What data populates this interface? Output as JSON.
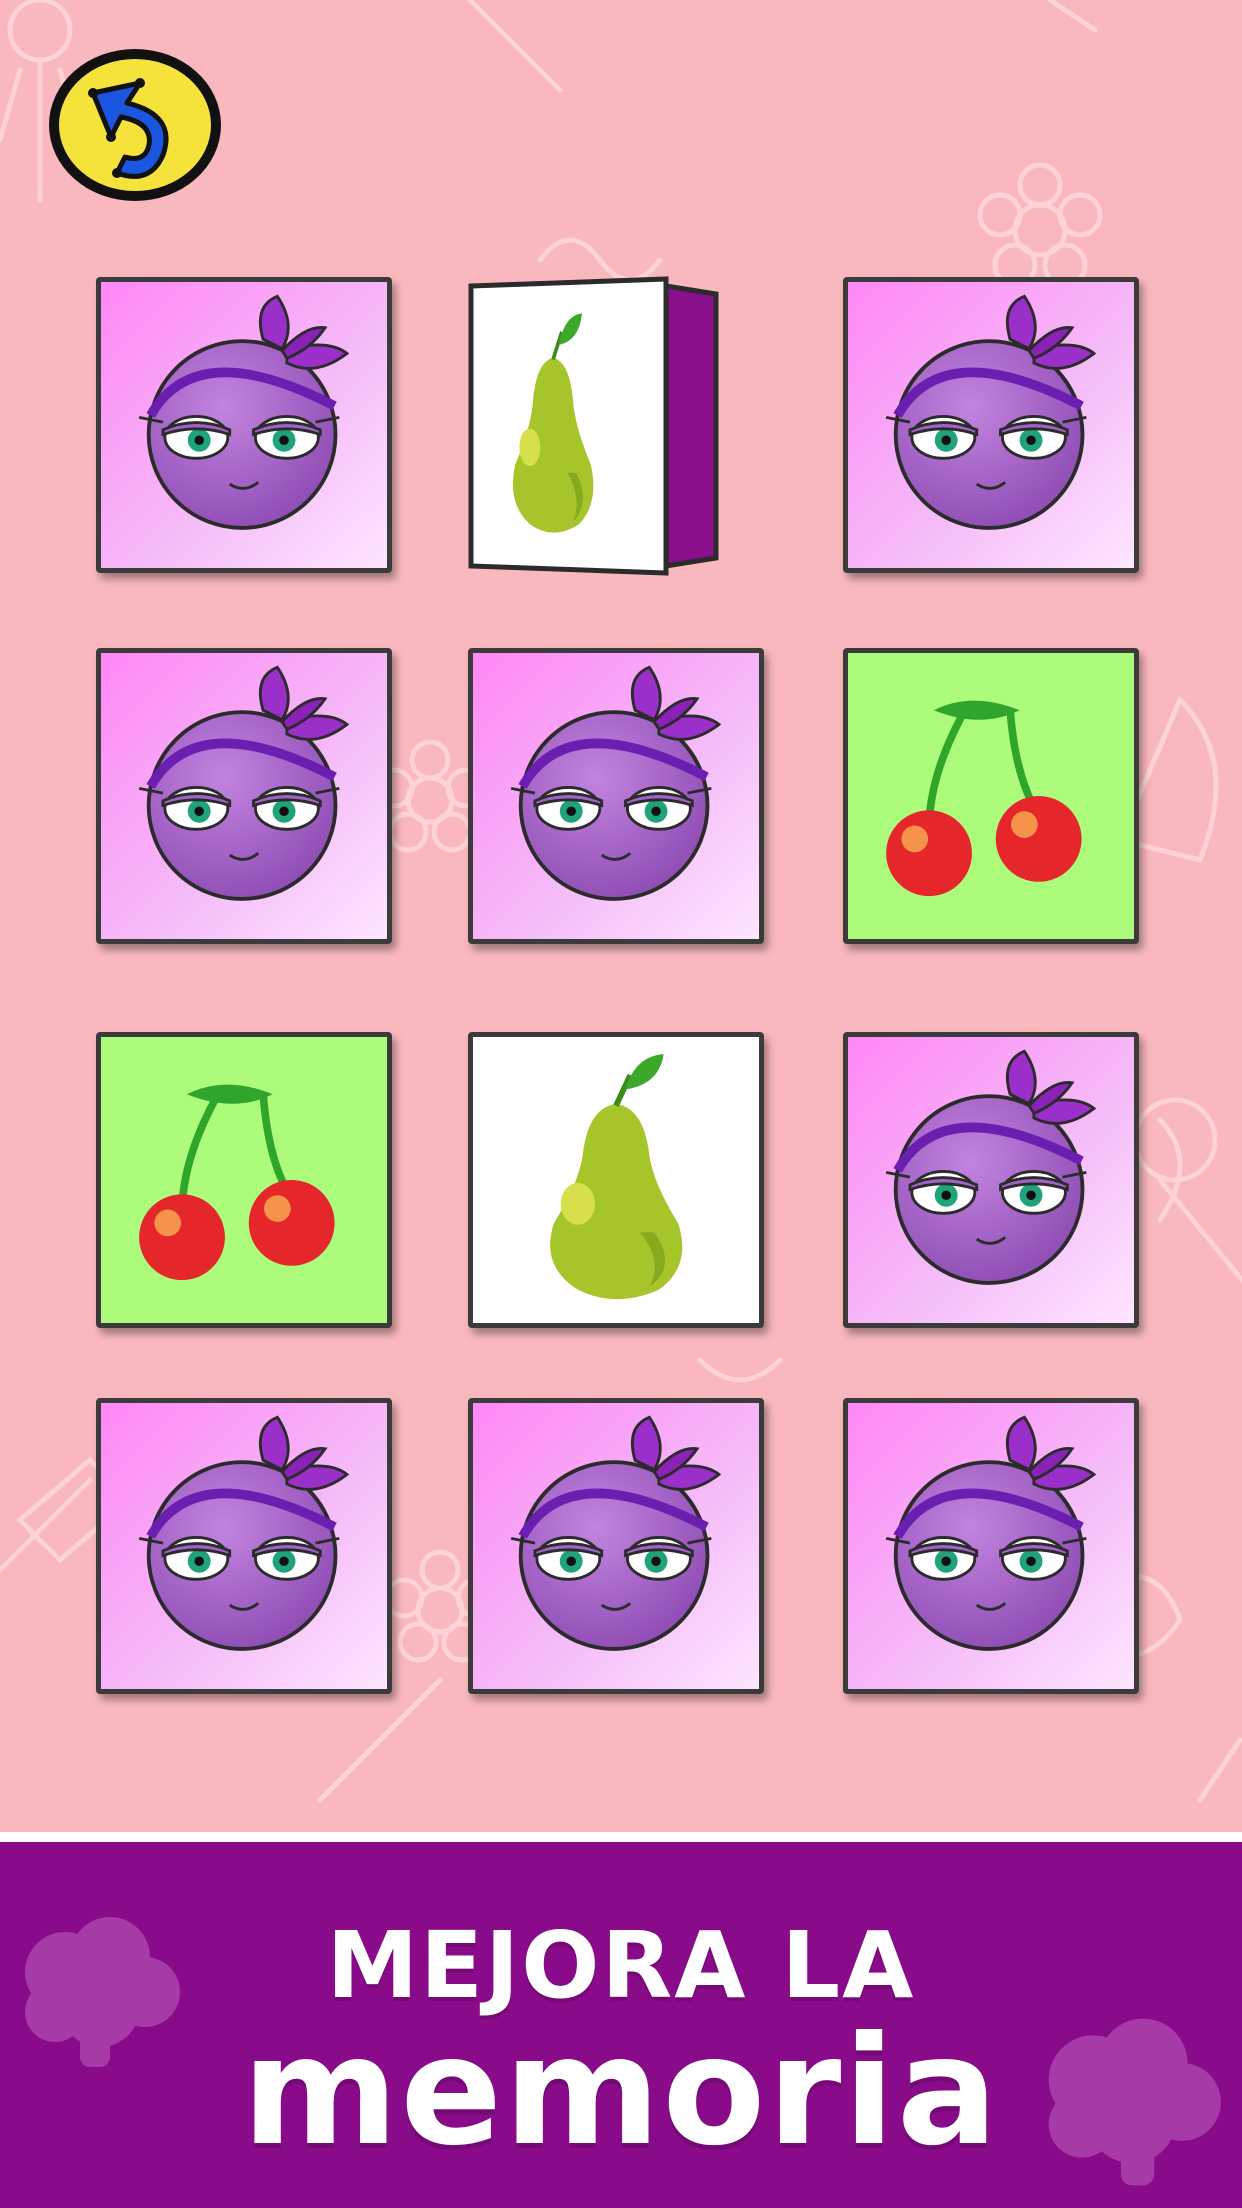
{
  "game": {
    "cards": [
      {
        "row": 1,
        "col": 1,
        "face": "back",
        "icon": "plum-face-icon"
      },
      {
        "row": 1,
        "col": 2,
        "face": "pear",
        "icon": "pear-icon",
        "state": "flipping"
      },
      {
        "row": 1,
        "col": 3,
        "face": "back",
        "icon": "plum-face-icon"
      },
      {
        "row": 2,
        "col": 1,
        "face": "back",
        "icon": "plum-face-icon"
      },
      {
        "row": 2,
        "col": 2,
        "face": "back",
        "icon": "plum-face-icon"
      },
      {
        "row": 2,
        "col": 3,
        "face": "cherry",
        "icon": "cherry-icon"
      },
      {
        "row": 3,
        "col": 1,
        "face": "cherry",
        "icon": "cherry-icon"
      },
      {
        "row": 3,
        "col": 2,
        "face": "pear",
        "icon": "pear-icon"
      },
      {
        "row": 3,
        "col": 3,
        "face": "back",
        "icon": "plum-face-icon"
      },
      {
        "row": 4,
        "col": 1,
        "face": "back",
        "icon": "plum-face-icon"
      },
      {
        "row": 4,
        "col": 2,
        "face": "back",
        "icon": "plum-face-icon"
      },
      {
        "row": 4,
        "col": 3,
        "face": "back",
        "icon": "plum-face-icon"
      }
    ],
    "back_button_icon": "back-arrow-icon"
  },
  "banner": {
    "line1": "MEJORA LA",
    "line2": "memoria"
  },
  "colors": {
    "background": "#f9b8bd",
    "banner": "#8a0b8a",
    "card_back": "#ff88f5",
    "cherry_card": "#adfb7b",
    "pear_card": "#ffffff"
  }
}
